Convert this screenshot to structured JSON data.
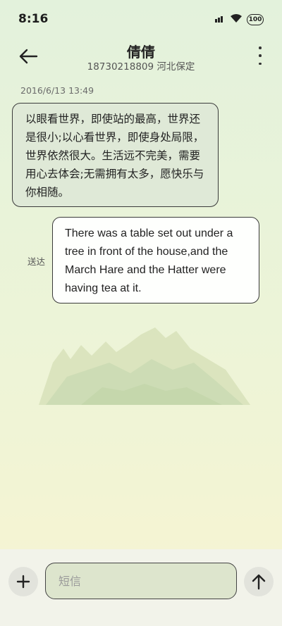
{
  "status": {
    "time": "8:16",
    "battery": "100"
  },
  "header": {
    "name": "倩倩",
    "subtitle": "18730218809 河北保定"
  },
  "conversation": {
    "date": "2016/6/13 13:49",
    "incoming_text": "以眼看世界，即使站的最高，世界还是很小;以心看世界，即使身处局限，世界依然很大。生活远不完美，需要用心去体会;无需拥有太多，愿快乐与你相随。",
    "sent_label": "送达",
    "outgoing_text": "There was a table set out under a tree in front of the house,and the March Hare and the Hatter were having tea at it."
  },
  "composer": {
    "placeholder": "短信"
  },
  "icons": {
    "back": "arrow-left-icon",
    "more": "more-vert-icon",
    "add": "plus-icon",
    "send": "arrow-up-icon",
    "wifi": "wifi-icon",
    "battery": "battery-icon"
  }
}
